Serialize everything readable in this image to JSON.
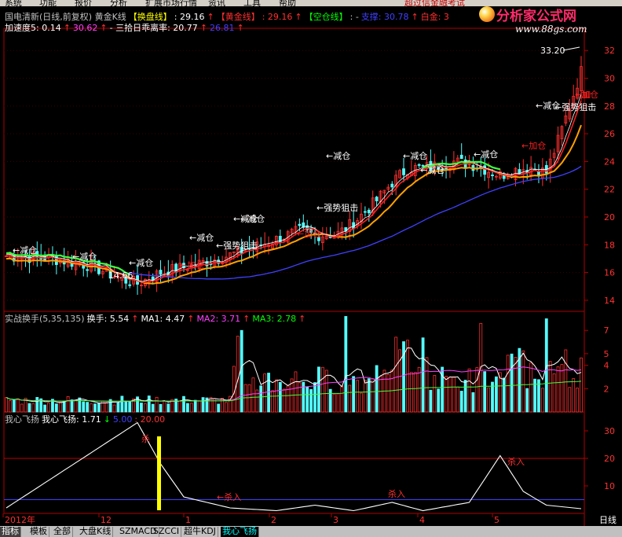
{
  "menubar": [
    "系统",
    "功能",
    "报价",
    "分析",
    "扩展市场行情",
    "资讯",
    "工具",
    "帮助"
  ],
  "menubar_right": "超过信金融考试",
  "logo": {
    "brand": "分析家公式网",
    "url": "www.88gs.com"
  },
  "price_panel": {
    "header": [
      {
        "text": "国电清新(日线,前复权) 黄金K线",
        "color": "#c0c0c0"
      },
      {
        "text": "【换盘线】",
        "color": "#ffff00"
      },
      {
        "text": ": 29.16",
        "color": "#ffffff"
      },
      {
        "text": "↑",
        "color": "#ff3030"
      },
      {
        "text": "【黄金线】",
        "color": "#ff3030"
      },
      {
        "text": ": 29.16",
        "color": "#ff3030"
      },
      {
        "text": "↑",
        "color": "#ff3030"
      },
      {
        "text": "【空仓线】",
        "color": "#00ff00"
      },
      {
        "text": ": -",
        "color": "#c0c0c0"
      },
      {
        "text": "支撑: 30.78",
        "color": "#4040ff"
      },
      {
        "text": "↑",
        "color": "#ff3030"
      },
      {
        "text": "白金: 3",
        "color": "#ff3030"
      }
    ],
    "header2": [
      {
        "text": "加速度5: 0.14",
        "color": "#ffffff"
      },
      {
        "text": "↑",
        "color": "#ff3030"
      },
      {
        "text": "30.62",
        "color": "#ff40ff"
      },
      {
        "text": "↑",
        "color": "#ff3030"
      },
      {
        "text": "- 三拾日乖离率: 20.77",
        "color": "#ffffff"
      },
      {
        "text": "↑",
        "color": "#ff3030"
      },
      {
        "text": "26.81",
        "color": "#4040ff"
      },
      {
        "text": "↑",
        "color": "#ff3030"
      }
    ],
    "y_ticks": [
      "32",
      "30",
      "28",
      "26",
      "24",
      "22",
      "20",
      "18",
      "16",
      "14"
    ],
    "y_range": [
      13.2,
      33.6
    ],
    "max_label": "33.20",
    "min_label": "14.66",
    "annotations": [
      {
        "text": "←减仓",
        "color": "#ffffff"
      },
      {
        "text": "←减仓",
        "color": "#ffffff"
      },
      {
        "text": "←减仓",
        "color": "#ffffff"
      },
      {
        "text": "←减仓",
        "color": "#ffffff"
      },
      {
        "text": "←减仓",
        "color": "#ffffff"
      },
      {
        "text": "←减仓",
        "color": "#ffffff"
      },
      {
        "text": "←减仓",
        "color": "#ffffff"
      },
      {
        "text": "←减仓",
        "color": "#ffffff"
      },
      {
        "text": "←减仓",
        "color": "#ffffff"
      },
      {
        "text": "←减仓",
        "color": "#ffffff"
      },
      {
        "text": "←减仓",
        "color": "#ffffff"
      },
      {
        "text": "←强势狙击",
        "color": "#ffffff"
      },
      {
        "text": "←强势狙击",
        "color": "#ffffff"
      },
      {
        "text": "←强势狙击",
        "color": "#ffffff"
      },
      {
        "text": "←加仓",
        "color": "#ff2020"
      },
      {
        "text": "←加仓",
        "color": "#ff2020"
      },
      {
        "text": "←加仓",
        "color": "#ff2020"
      },
      {
        "text": "加仓",
        "color": "#ff2020"
      },
      {
        "text": "←加",
        "color": "#ff2020"
      }
    ]
  },
  "volume_panel": {
    "header": [
      {
        "text": "实战换手(5,35,135)",
        "color": "#c0c0c0"
      },
      {
        "text": "换手: 5.54",
        "color": "#ffffff"
      },
      {
        "text": "↑",
        "color": "#ff3030"
      },
      {
        "text": "MA1: 4.47",
        "color": "#ffffff"
      },
      {
        "text": "↑",
        "color": "#ff3030"
      },
      {
        "text": "MA2: 3.71",
        "color": "#ff40ff"
      },
      {
        "text": "↑",
        "color": "#ff3030"
      },
      {
        "text": "MA3: 2.78",
        "color": "#00ff00"
      },
      {
        "text": "↑",
        "color": "#ff3030"
      }
    ],
    "y_ticks": [
      "7",
      "5",
      "4",
      "2"
    ]
  },
  "indicator_panel": {
    "header": [
      {
        "text": "我心飞扬",
        "color": "#c0c0c0"
      },
      {
        "text": "我心飞扬: 1.71",
        "color": "#ffffff"
      },
      {
        "text": "↓",
        "color": "#00ff00"
      },
      {
        "text": "5.00",
        "color": "#4040ff"
      },
      {
        "text": ": 20.00",
        "color": "#ff3030"
      }
    ],
    "y_ticks": [
      "30",
      "20",
      "10"
    ],
    "annotations": [
      {
        "text": "杀",
        "color": "#ff3030"
      },
      {
        "text": "杀入",
        "color": "#ff3030"
      },
      {
        "text": "←杀入",
        "color": "#ff3030"
      },
      {
        "text": "杀入",
        "color": "#ff3030"
      }
    ]
  },
  "x_axis": {
    "labels": [
      "2012年",
      "12",
      "1",
      "2",
      "3",
      "4",
      "5"
    ],
    "right_label": "日线"
  },
  "tabs": [
    "指标",
    "模板",
    "全部",
    "大盘K线",
    "SZMACD",
    "SZCCI",
    "超牛KDJ",
    "我心飞扬"
  ],
  "active_tab": "我心飞扬",
  "colors": {
    "up": "#ff3030",
    "down": "#54ffff",
    "grid": "#800000",
    "border": "#b00000",
    "blue": "#4040ff",
    "gold": "#ffa000",
    "green": "#40ff40",
    "yellow": "#ffff00"
  }
}
